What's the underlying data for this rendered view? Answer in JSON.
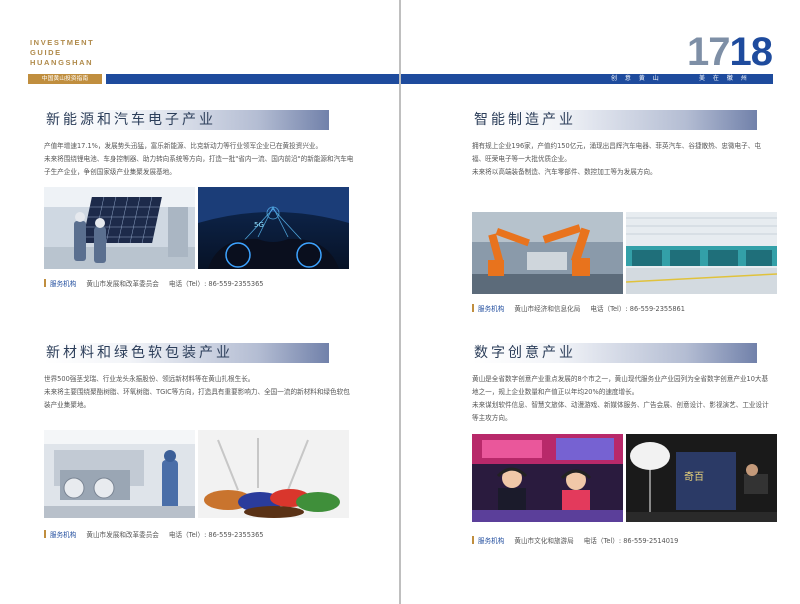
{
  "brand": {
    "lines": [
      "INVESTMENT",
      "GUIDE",
      "HUANGSHAN"
    ],
    "tag": "中国黄山投资指南"
  },
  "page_numbers": {
    "left": "17",
    "right": "18"
  },
  "slogan": {
    "left": "创 意 黄 山",
    "right": "美 在 徽 州"
  },
  "sections": [
    {
      "title": "新能源和汽车电子产业",
      "paragraphs": [
        "产值年增速17.1%，发展势头迅猛，富乐新能源、比克新动力等行业领军企业已在黄投资兴业。",
        "未来将围绕锂电池、车身控制器、助力转向系统等方向，打造一批\"省内一流、国内前沿\"的新能源和汽车电子生产企业，争创国家级产业集聚发展基地。"
      ],
      "service": {
        "label": "服务机构",
        "org": "黄山市发展和改革委员会",
        "tel": "电话（Tel）: 86-559-2355365"
      }
    },
    {
      "title": "智能制造产业",
      "paragraphs": [
        "拥有规上企业196家，产值约150亿元，涌现出昌辉汽车电器、菲英汽车、谷捷散热、忠微电子、屯福、旺荣电子等一大批优质企业。",
        "未来将以高端装备制造、汽车零部件、数控加工等为发展方向。"
      ],
      "service": {
        "label": "服务机构",
        "org": "黄山市经济和信息化局",
        "tel": "电话（Tel）: 86-559-2355861"
      }
    },
    {
      "title": "新材料和绿色软包装产业",
      "paragraphs": [
        "世界500强茎戈瑞、行业龙头永振股份、领远新材料等在黄山扎根生长。",
        "未来将主要围绕聚酯树脂、环氧树脂、TGIC等方向，打造具有重要影响力、全国一流的新材料和绿色软包装产业集聚地。"
      ],
      "service": {
        "label": "服务机构",
        "org": "黄山市发展和改革委员会",
        "tel": "电话（Tel）: 86-559-2355365"
      }
    },
    {
      "title": "数字创意产业",
      "paragraphs": [
        "黄山是全省数字创意产业重点发展的8个市之一，黄山现代服务业产业园列为全省数字创意产业10大基地之一，规上企业数量和产值正以年均20%的速度增长。",
        "未来谋划软件信息、智慧文旅体、动漫游戏、新媒体服务、广告会展、创意设计、影视演艺、工业设计等主攻方向。"
      ],
      "service": {
        "label": "服务机构",
        "org": "黄山市文化和旅游局",
        "tel": "电话（Tel）: 86-559-2514019"
      }
    }
  ]
}
